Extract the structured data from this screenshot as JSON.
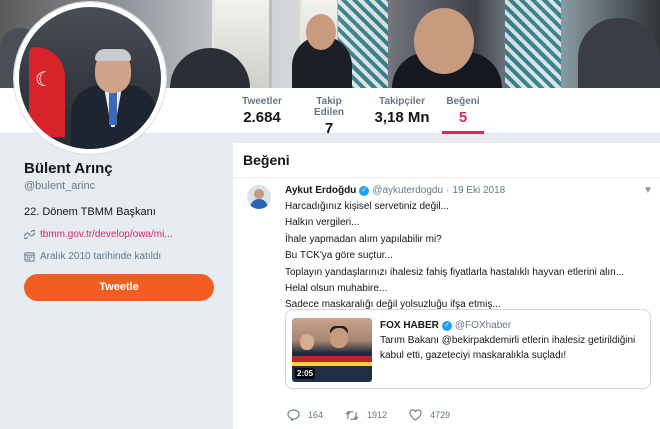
{
  "nav": {
    "items": [
      {
        "label": "Tweetler",
        "value": "2.684"
      },
      {
        "label": "Takip Edilen",
        "value": "7"
      },
      {
        "label": "Takipçiler",
        "value": "3,18 Mn"
      },
      {
        "label": "Beğeni",
        "value": "5"
      }
    ],
    "active_index": 3
  },
  "profile": {
    "name": "Bülent Arınç",
    "handle": "@bulent_arinc",
    "bio": "22. Dönem TBMM Başkanı",
    "link": "tbmm.gov.tr/develop/owa/mi...",
    "joined": "Aralık 2010 tarihinde katıldı",
    "tweet_button": "Tweetle"
  },
  "timeline": {
    "title": "Beğeni",
    "tweet": {
      "author": "Aykut Erdoğdu",
      "handle": "@aykuterdogdu",
      "dot": "·",
      "date": "19 Eki 2018",
      "lines": [
        "Harcadığınız kişisel servetiniz değil...",
        "Halkın vergileri...",
        "İhale yapmadan alım yapılabilir mi?",
        "Bu TCK'ya göre suçtur...",
        "Toplayın yandaşlarınızı ihalesiz fahiş fiyatlarla hastalıklı hayvan etlerini alın...",
        "Helal olsun muhabire...",
        "Sadece maskaralığı değil yolsuzluğu ifşa etmiş..."
      ],
      "quote": {
        "author": "FOX HABER",
        "handle": "@FOXhaber",
        "text": "Tarım Bakanı @bekirpakdemirli etlerin ihalesiz getirildiğini kabul etti, gazeteciyi maskaralıkla suçladı!",
        "video_time": "2:05"
      },
      "actions": {
        "replies": "164",
        "retweets": "1912",
        "likes": "4729"
      }
    }
  },
  "colors": {
    "accent": "#e0245e",
    "button": "#f45d22",
    "link": "#e0245e",
    "verified": "#1da1f2"
  },
  "icons": [
    "link-icon",
    "calendar-icon",
    "verified-icon",
    "chevron-down-icon",
    "reply-icon",
    "retweet-icon",
    "like-icon"
  ]
}
